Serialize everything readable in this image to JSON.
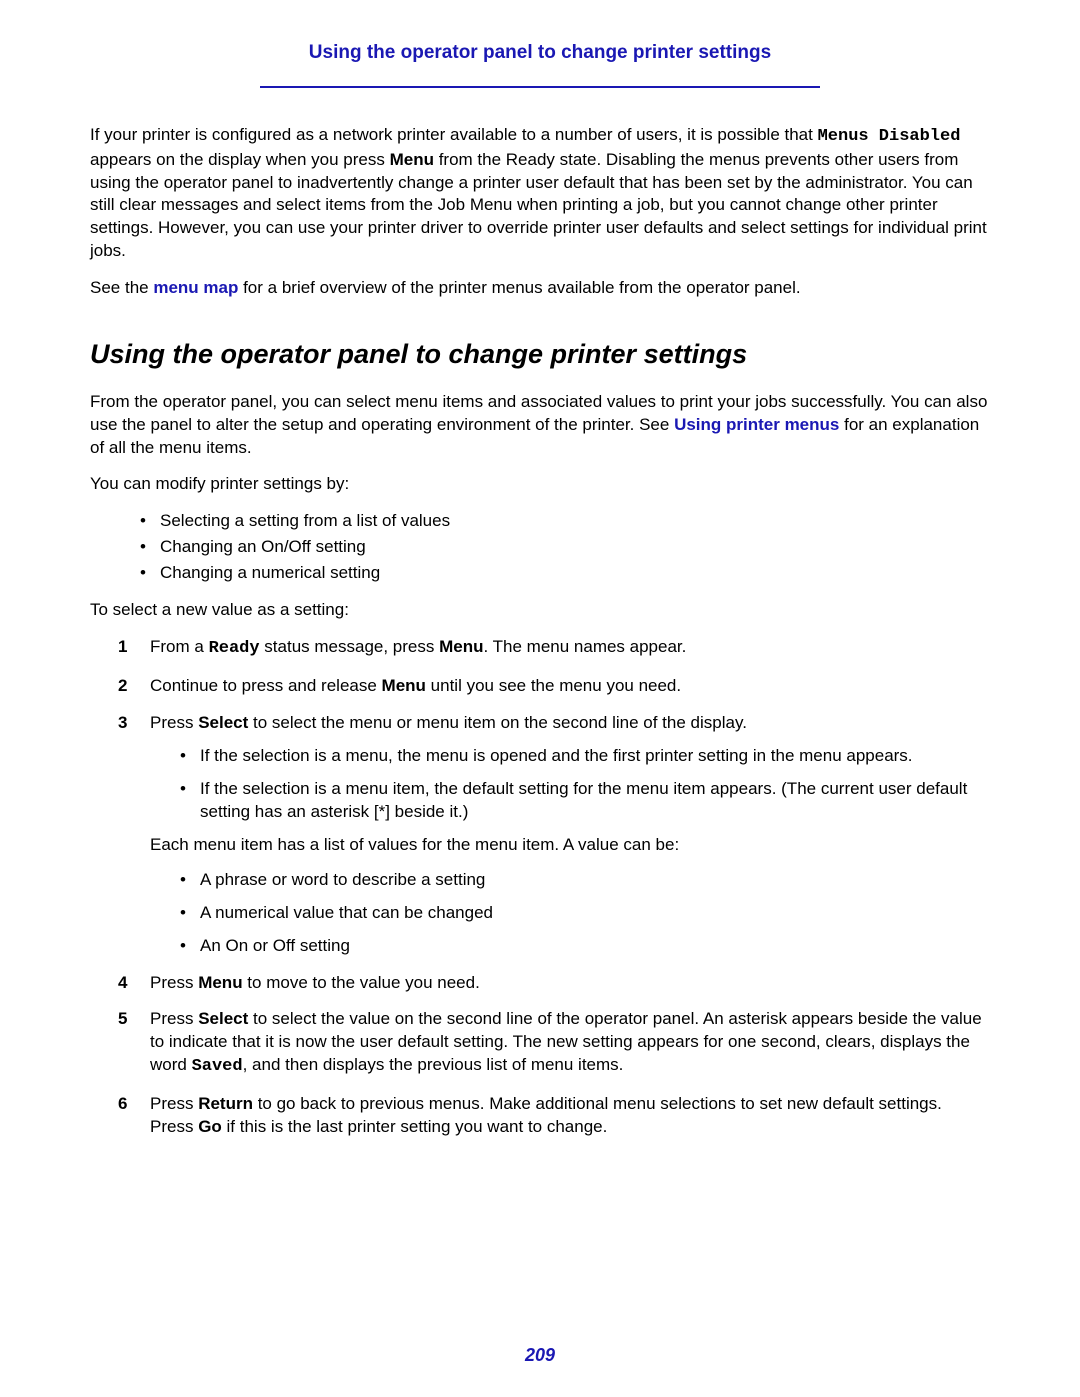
{
  "header": {
    "title": "Using the operator panel to change printer settings"
  },
  "para1": {
    "t1": "If your printer is configured as a network printer available to a number of users, it is possible that ",
    "mono": "Menus Disabled",
    "t2": " appears on the display when you press ",
    "b1": "Menu",
    "t3": " from the Ready state. Disabling the menus prevents other users from using the operator panel to inadvertently change a printer user default that has been set by the administrator. You can still clear messages and select items from the Job Menu when printing a job, but you cannot change other printer settings. However, you can use your printer driver to override printer user defaults and select settings for individual print jobs."
  },
  "para2": {
    "t1": "See the ",
    "link": "menu map",
    "t2": " for a brief overview of the printer menus available from the operator panel."
  },
  "section_heading": "Using the operator panel to change printer settings",
  "para3": {
    "t1": "From the operator panel, you can select menu items and associated values to print your jobs successfully. You can also use the panel to alter the setup and operating environment of the printer. See ",
    "link": "Using printer menus",
    "t2": " for an explanation of all the menu items."
  },
  "para4": "You can modify printer settings by:",
  "bullets1": [
    "Selecting a setting from a list of values",
    "Changing an On/Off setting",
    "Changing a numerical setting"
  ],
  "para5": "To select a new value as a setting:",
  "steps": {
    "s1": {
      "t1": "From a ",
      "mono": "Ready",
      "t2": " status message, press ",
      "b": "Menu",
      "t3": ". The menu names appear."
    },
    "s2": {
      "t1": "Continue to press and release ",
      "b": "Menu",
      "t2": " until you see the menu you need."
    },
    "s3": {
      "t1": "Press ",
      "b": "Select",
      "t2": " to select the menu or menu item on the second line of the display.",
      "sub": [
        "If the selection is a menu, the menu is opened and the first printer setting in the menu appears.",
        "If the selection is a menu item, the default setting for the menu item appears. (The current user default setting has an asterisk [*] beside it.)"
      ],
      "note": "Each menu item has a list of values for the menu item. A value can be:",
      "sub2": [
        "A phrase or word to describe a setting",
        "A numerical value that can be changed",
        "An On or Off setting"
      ]
    },
    "s4": {
      "t1": "Press ",
      "b": "Menu",
      "t2": " to move to the value you need."
    },
    "s5": {
      "t1": "Press ",
      "b": "Select",
      "t2": " to select the value on the second line of the operator panel. An asterisk appears beside the value to indicate that it is now the user default setting. The new setting appears for one second, clears, displays the word ",
      "mono": "Saved",
      "t3": ", and then displays the previous list of menu items."
    },
    "s6": {
      "t1": "Press ",
      "b1": "Return",
      "t2": " to go back to previous menus. Make additional menu selections to set new default settings. Press ",
      "b2": "Go",
      "t3": " if this is the last printer setting you want to change."
    }
  },
  "page_number": "209"
}
